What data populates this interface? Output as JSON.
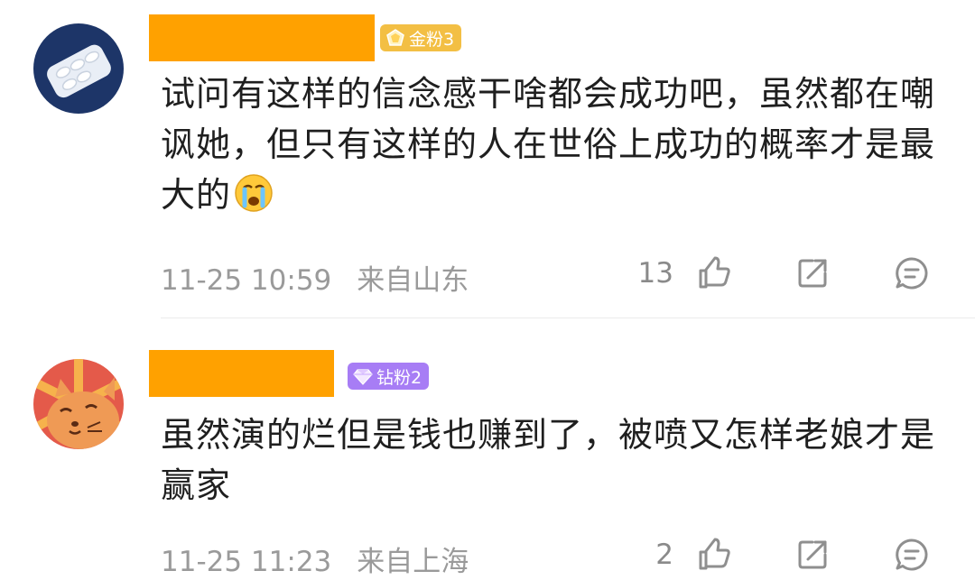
{
  "comments": [
    {
      "badge": "金粉3",
      "badge_color": "#f3bf44",
      "name_block_color": "#ffa100",
      "text": "试问有这样的信念感干啥都会成功吧，虽然都在嘲讽她，但只有这样的人在世俗上成功的概率才是最大的",
      "emoji": "crying-face-icon",
      "time": "11-25 10:59",
      "location": "来自山东",
      "likes": "13"
    },
    {
      "badge": "钻粉2",
      "badge_color": "#a77df5",
      "name_block_color": "#ffa100",
      "text": "虽然演的烂但是钱也赚到了，被喷又怎样老娘才是赢家",
      "time": "11-25 11:23",
      "location": "来自上海",
      "likes": "2"
    }
  ]
}
